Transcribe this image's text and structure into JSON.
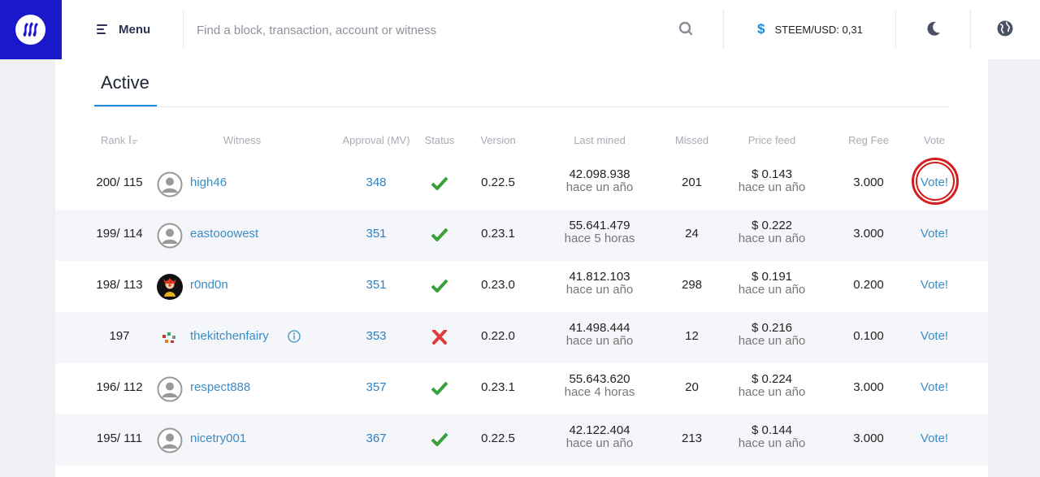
{
  "header": {
    "menu_label": "Menu",
    "search_placeholder": "Find a block, transaction, account or witness",
    "price_symbol": "$",
    "price_label": "STEEM/USD: 0,31",
    "brand_color": "#1a19c9",
    "accent_color": "#1e88d6"
  },
  "tabs": {
    "active_label": "Active"
  },
  "columns": {
    "rank": "Rank",
    "witness": "Witness",
    "approval": "Approval (MV)",
    "status": "Status",
    "version": "Version",
    "last_mined": "Last mined",
    "missed": "Missed",
    "price_feed": "Price feed",
    "reg_fee": "Reg Fee",
    "vote": "Vote"
  },
  "rows": [
    {
      "rank": "200/ 115",
      "name": "high46",
      "approval": "348",
      "status": "ok",
      "version": "0.22.5",
      "last_block": "42.098.938",
      "last_time": "hace un año",
      "missed": "201",
      "price": "$ 0.143",
      "price_time": "hace un año",
      "fee": "3.000",
      "vote": "Vote!",
      "avatar": "default-avatar"
    },
    {
      "rank": "199/ 114",
      "name": "eastooowest",
      "approval": "351",
      "status": "ok",
      "version": "0.23.1",
      "last_block": "55.641.479",
      "last_time": "hace 5 horas",
      "missed": "24",
      "price": "$ 0.222",
      "price_time": "hace un año",
      "fee": "3.000",
      "vote": "Vote!",
      "avatar": "default-avatar"
    },
    {
      "rank": "198/ 113",
      "name": "r0nd0n",
      "approval": "351",
      "status": "ok",
      "version": "0.23.0",
      "last_block": "41.812.103",
      "last_time": "hace un año",
      "missed": "298",
      "price": "$ 0.191",
      "price_time": "hace un año",
      "fee": "0.200",
      "vote": "Vote!",
      "avatar": "clown-avatar"
    },
    {
      "rank": "197",
      "name": "thekitchenfairy",
      "approval": "353",
      "status": "disabled",
      "version": "0.22.0",
      "last_block": "41.498.444",
      "last_time": "hace un año",
      "missed": "12",
      "price": "$ 0.216",
      "price_time": "hace un año",
      "fee": "0.100",
      "vote": "Vote!",
      "avatar": "kitchen-avatar"
    },
    {
      "rank": "196/ 112",
      "name": "respect888",
      "approval": "357",
      "status": "ok",
      "version": "0.23.1",
      "last_block": "55.643.620",
      "last_time": "hace 4 horas",
      "missed": "20",
      "price": "$ 0.224",
      "price_time": "hace un año",
      "fee": "3.000",
      "vote": "Vote!",
      "avatar": "default-avatar"
    },
    {
      "rank": "195/ 111",
      "name": "nicetry001",
      "approval": "367",
      "status": "ok",
      "version": "0.22.5",
      "last_block": "42.122.404",
      "last_time": "hace un año",
      "missed": "213",
      "price": "$ 0.144",
      "price_time": "hace un año",
      "fee": "3.000",
      "vote": "Vote!",
      "avatar": "default-avatar"
    }
  ],
  "icons": {
    "status_ok": "checkmark-icon",
    "status_disabled": "x-mark-icon",
    "info": "info-icon",
    "sort": "sort-icon"
  },
  "colors": {
    "ok": "#3aa03a",
    "disabled": "#e03a3a",
    "link": "#3c8dc4",
    "highlight": "#d41c1c"
  }
}
